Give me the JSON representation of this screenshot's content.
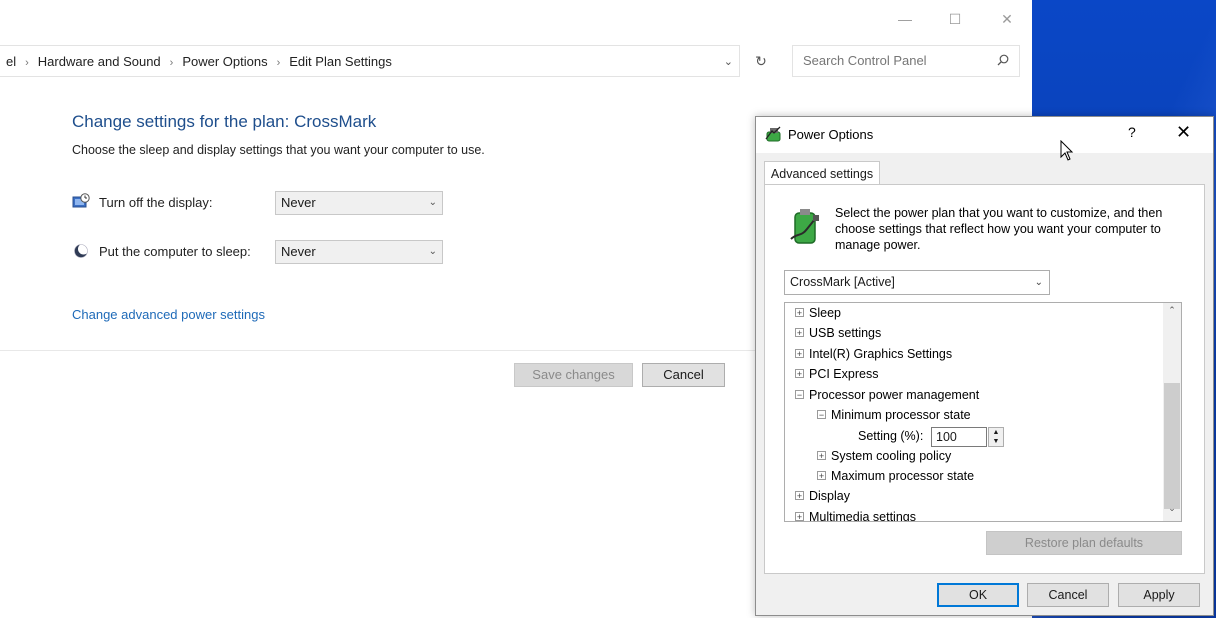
{
  "window": {
    "min_icon": "minimize-icon",
    "max_icon": "maximize-icon",
    "close_icon": "close-icon"
  },
  "breadcrumb": {
    "partial": "el",
    "items": [
      "Hardware and Sound",
      "Power Options",
      "Edit Plan Settings"
    ]
  },
  "search": {
    "placeholder": "Search Control Panel"
  },
  "main": {
    "heading": "Change settings for the plan: CrossMark",
    "subtext": "Choose the sleep and display settings that you want your computer to use.",
    "display_label": "Turn off the display:",
    "display_value": "Never",
    "sleep_label": "Put the computer to sleep:",
    "sleep_value": "Never",
    "advanced_link": "Change advanced power settings",
    "save_label": "Save changes",
    "cancel_label": "Cancel"
  },
  "dialog": {
    "title": "Power Options",
    "help": "?",
    "close": "✕",
    "tab": "Advanced settings",
    "description": "Select the power plan that you want to customize, and then choose settings that reflect how you want your computer to manage power.",
    "plan": "CrossMark [Active]",
    "tree": [
      {
        "label": "Sleep",
        "sign": "+"
      },
      {
        "label": "USB settings",
        "sign": "+"
      },
      {
        "label": "Intel(R) Graphics Settings",
        "sign": "+"
      },
      {
        "label": "PCI Express",
        "sign": "+"
      },
      {
        "label": "Processor power management",
        "sign": "−"
      },
      {
        "label": "Minimum processor state",
        "sign": "−"
      },
      {
        "label": "Setting (%):",
        "sign": ""
      },
      {
        "label": "System cooling policy",
        "sign": "+"
      },
      {
        "label": "Maximum processor state",
        "sign": "+"
      },
      {
        "label": "Display",
        "sign": "+"
      },
      {
        "label": "Multimedia settings",
        "sign": "+"
      }
    ],
    "setting_value": "100",
    "restore": "Restore plan defaults",
    "ok": "OK",
    "cancel": "Cancel",
    "apply": "Apply"
  },
  "colors": {
    "heading": "#1e4e8c",
    "link": "#1e6ab8",
    "desktop": "#0a47c7",
    "ok_border": "#0078d7"
  }
}
